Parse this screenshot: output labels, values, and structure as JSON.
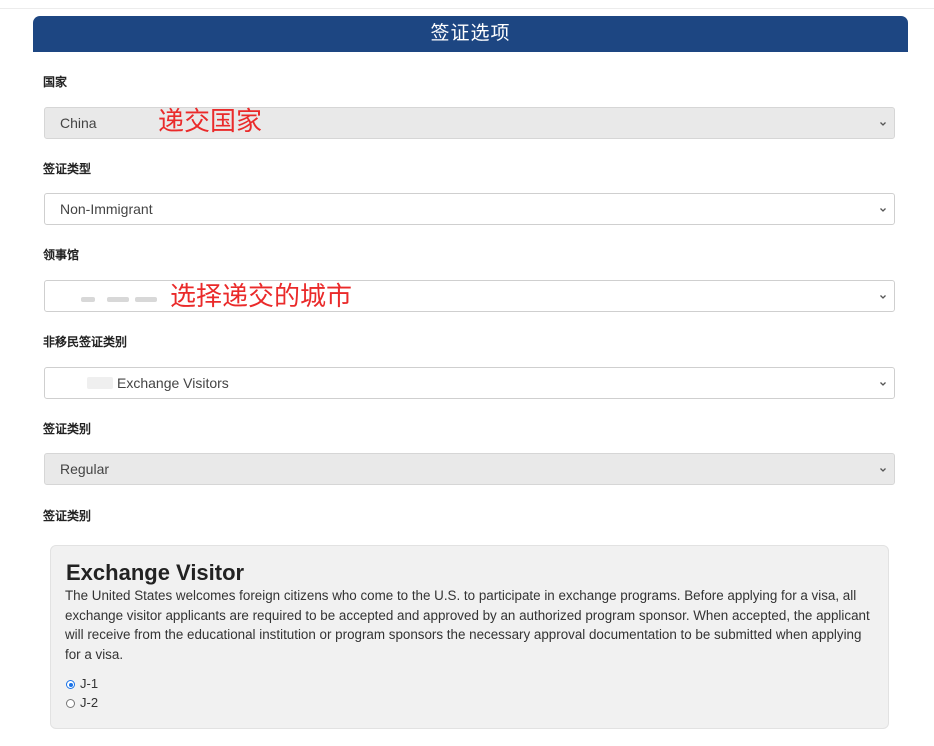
{
  "header": {
    "title": "签证选项"
  },
  "fields": [
    {
      "label": "国家",
      "value": "China",
      "disabled": true,
      "annotation": "递交国家"
    },
    {
      "label": "签证类型",
      "value": "Non-Immigrant",
      "disabled": false
    },
    {
      "label": "领事馆",
      "value": "",
      "disabled": false,
      "annotation": "选择递交的城市"
    },
    {
      "label": "非移民签证类别",
      "value": "Exchange Visitors",
      "disabled": false
    },
    {
      "label": "签证类别",
      "value": "Regular",
      "disabled": true
    }
  ],
  "visa_section": {
    "label": "签证类别",
    "card_title": "Exchange Visitor",
    "description": "The United States welcomes foreign citizens who come to the U.S. to participate in exchange programs. Before applying for a visa, all exchange visitor applicants are required to be accepted and approved by an authorized program sponsor. When accepted, the applicant will receive from the educational institution or program sponsors the necessary approval documentation to be submitted when applying for a visa.",
    "options": [
      {
        "label": "J-1",
        "checked": true
      },
      {
        "label": "J-2",
        "checked": false
      }
    ]
  },
  "icons": {
    "dropdown": "chevron-down-icon",
    "radio_selected": "radio-selected-icon",
    "radio_unselected": "radio-unselected-icon"
  },
  "colors": {
    "header_bg": "#1d4682",
    "annotation": "#ea2a2a",
    "radio_accent": "#1a73e8"
  }
}
